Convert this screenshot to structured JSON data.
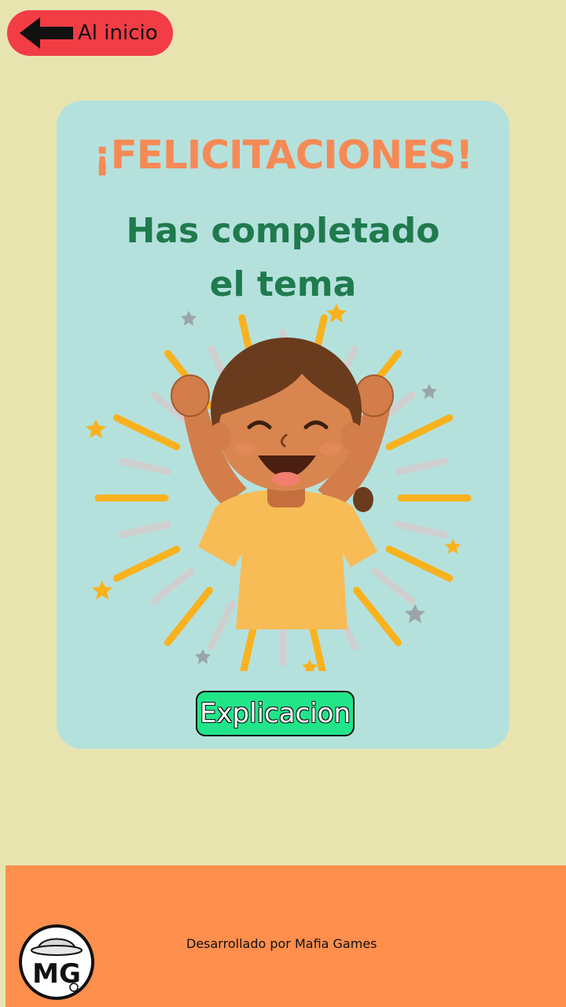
{
  "nav": {
    "back_label": "Al inicio"
  },
  "card": {
    "title": "¡FELICITACIONES!",
    "subtitle_line1": "Has completado",
    "subtitle_line2": "el tema",
    "explain_label": "Explicacion"
  },
  "footer": {
    "credit": "Desarrollado por Mafia Games",
    "logo_text": "MG"
  },
  "colors": {
    "page_bg": "#e8e4b0",
    "back_button": "#f23d45",
    "card_bg": "#b5e1dd",
    "title": "#f58a56",
    "subtitle": "#1f7a4d",
    "explain_button": "#22e58a",
    "footer_bg": "#ff8f4c"
  }
}
